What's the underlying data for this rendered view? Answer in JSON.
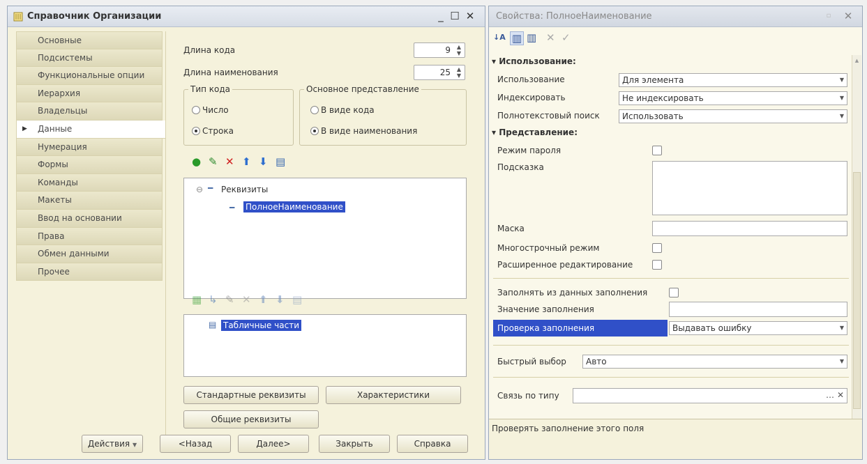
{
  "left_window": {
    "title": "Справочник Организации",
    "controls": {
      "minimize": "_",
      "maximize": "☐",
      "close": "✕"
    },
    "nav": [
      {
        "label": "Основные",
        "active": false
      },
      {
        "label": "Подсистемы",
        "active": false
      },
      {
        "label": "Функциональные опции",
        "active": false
      },
      {
        "label": "Иерархия",
        "active": false
      },
      {
        "label": "Владельцы",
        "active": false
      },
      {
        "label": "Данные",
        "active": true
      },
      {
        "label": "Нумерация",
        "active": false
      },
      {
        "label": "Формы",
        "active": false
      },
      {
        "label": "Команды",
        "active": false
      },
      {
        "label": "Макеты",
        "active": false
      },
      {
        "label": "Ввод на основании",
        "active": false
      },
      {
        "label": "Права",
        "active": false
      },
      {
        "label": "Обмен данными",
        "active": false
      },
      {
        "label": "Прочее",
        "active": false
      }
    ],
    "code_length": {
      "label": "Длина кода",
      "value": "9"
    },
    "name_length": {
      "label": "Длина наименования",
      "value": "25"
    },
    "code_type": {
      "legend": "Тип кода",
      "options": [
        "Число",
        "Строка"
      ],
      "selected": "Строка"
    },
    "main_repr": {
      "legend": "Основное представление",
      "options": [
        "В виде кода",
        "В виде наименования"
      ],
      "selected": "В виде наименования"
    },
    "attributes_tree": {
      "root": "Реквизиты",
      "child": "ПолноеНаименование"
    },
    "tabular_tree": {
      "root": "Табличные части"
    },
    "buttons": {
      "standard_attrs": "Стандартные реквизиты",
      "characteristics": "Характеристики",
      "common_attrs": "Общие реквизиты",
      "actions": "Действия",
      "back": "<Назад",
      "next": "Далее>",
      "close": "Закрыть",
      "help": "Справка"
    }
  },
  "right_window": {
    "title": "Свойства: ПолноеНаименование",
    "controls": {
      "pin": "▫",
      "close": "✕"
    },
    "sections": {
      "usage": "Использование:",
      "presentation": "Представление:"
    },
    "props": {
      "usage": {
        "label": "Использование",
        "value": "Для элемента"
      },
      "index": {
        "label": "Индексировать",
        "value": "Не индексировать"
      },
      "fulltext": {
        "label": "Полнотекстовый поиск",
        "value": "Использовать"
      },
      "password_mode": {
        "label": "Режим пароля"
      },
      "tooltip": {
        "label": "Подсказка",
        "value": ""
      },
      "mask": {
        "label": "Маска",
        "value": ""
      },
      "multiline": {
        "label": "Многострочный режим"
      },
      "extended_edit": {
        "label": "Расширенное редактирование"
      },
      "fill_from_data": {
        "label": "Заполнять из данных заполнения"
      },
      "fill_value": {
        "label": "Значение заполнения",
        "value": ""
      },
      "fill_check": {
        "label": "Проверка заполнения",
        "value": "Выдавать ошибку"
      },
      "quick_choice": {
        "label": "Быстрый выбор",
        "value": "Авто"
      },
      "type_link": {
        "label": "Связь по типу",
        "value": ""
      }
    },
    "description": "Проверять заполнение этого поля"
  },
  "colors": {
    "selection": "#3050c8",
    "panel": "#f5f2dc",
    "titlebar": "#dde3eb"
  }
}
